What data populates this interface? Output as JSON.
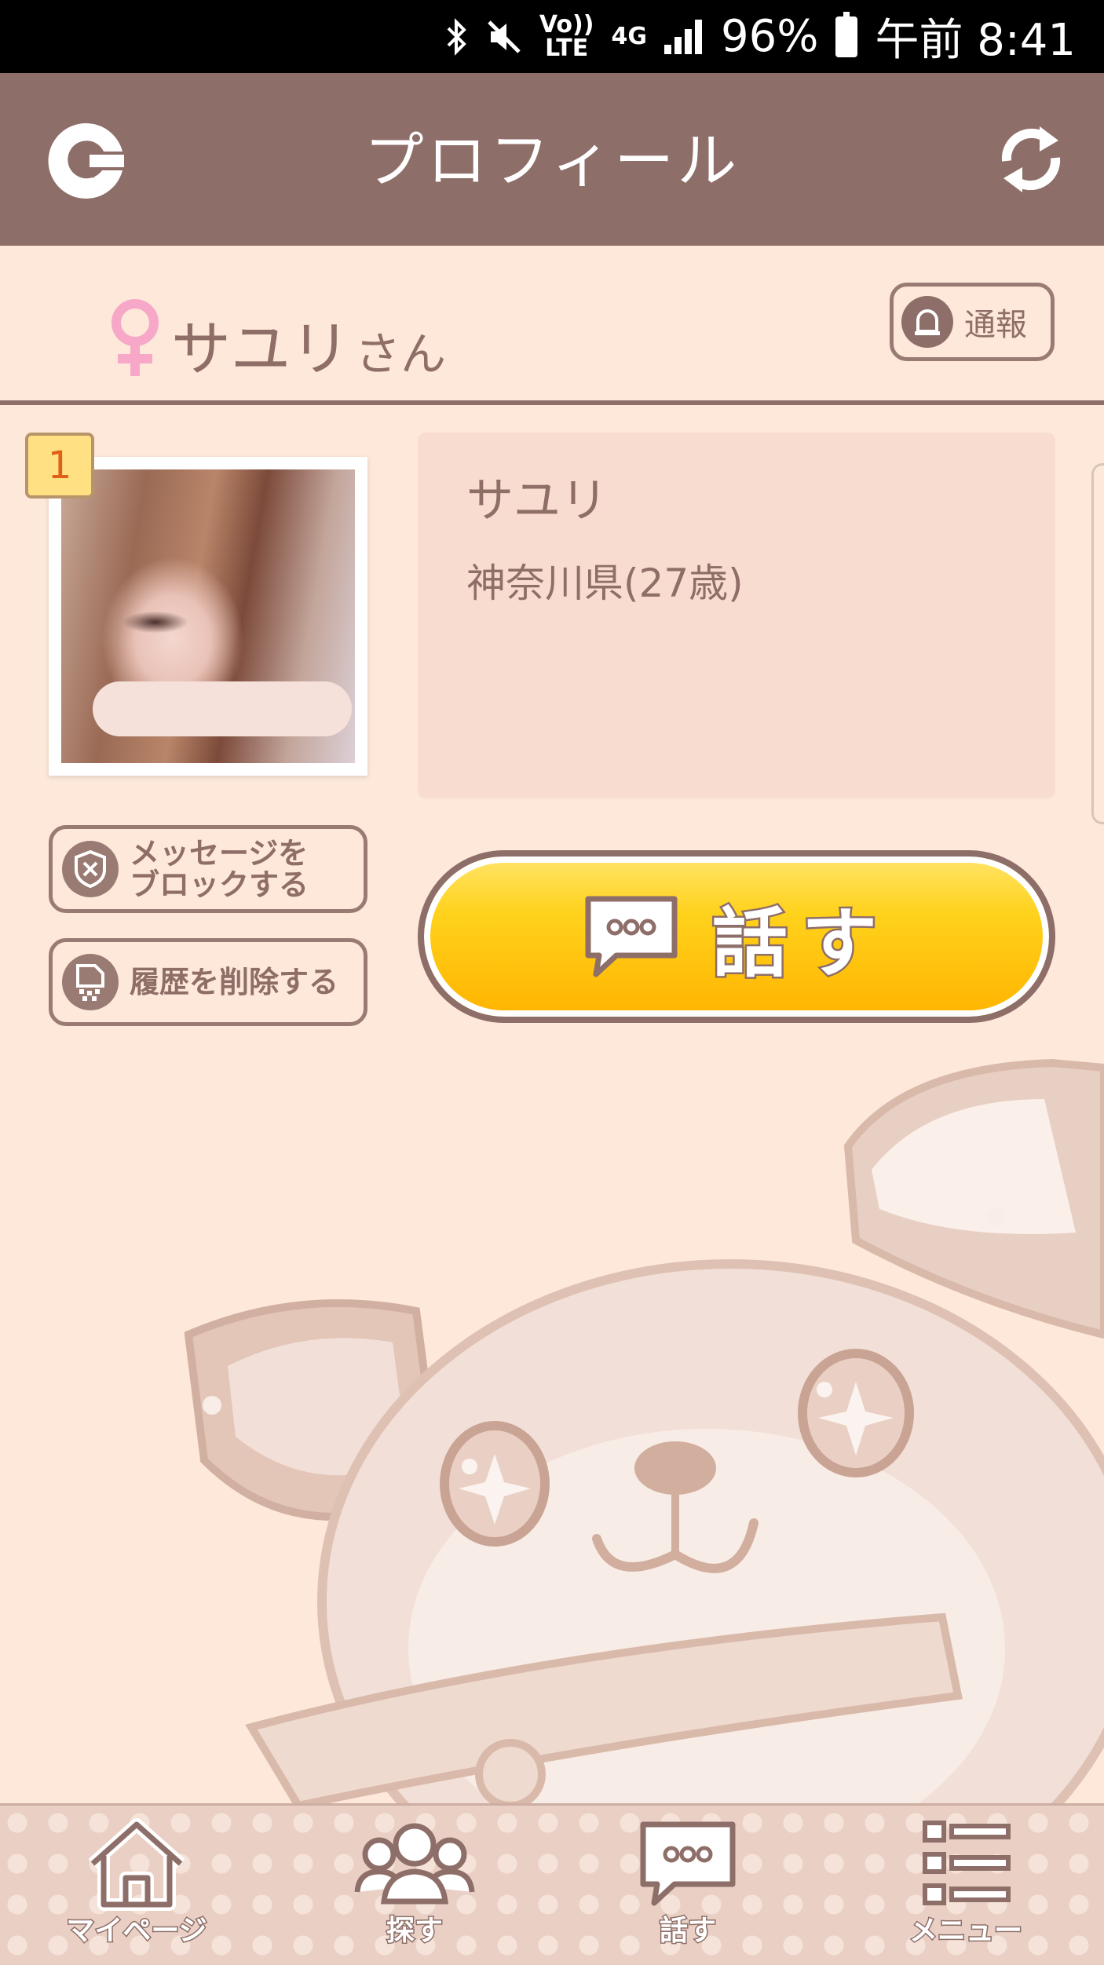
{
  "status_bar": {
    "network_top": "Vo))",
    "network_bottom": "LTE",
    "data_type": "4G",
    "battery": "96%",
    "time": "午前 8:41"
  },
  "header": {
    "title": "プロフィール"
  },
  "profile": {
    "name": "サユリ",
    "honorific": "さん",
    "report_label": "通報",
    "photo_badge": "1",
    "info_name": "サユリ",
    "info_location": "神奈川県(27歳)"
  },
  "actions": {
    "block_line1": "メッセージを",
    "block_line2": "ブロックする",
    "delete_history": "履歴を削除する",
    "talk": "話す"
  },
  "bottom_nav": {
    "items": [
      {
        "label": "マイページ",
        "icon": "home-icon"
      },
      {
        "label": "探す",
        "icon": "people-icon"
      },
      {
        "label": "話す",
        "icon": "chat-bubble-icon"
      },
      {
        "label": "メニュー",
        "icon": "menu-list-icon"
      }
    ]
  },
  "colors": {
    "header_bg": "#8E6E68",
    "page_bg": "#FDE8DA",
    "talk_button": "#FFC400",
    "female_icon": "#F7A8C8"
  }
}
